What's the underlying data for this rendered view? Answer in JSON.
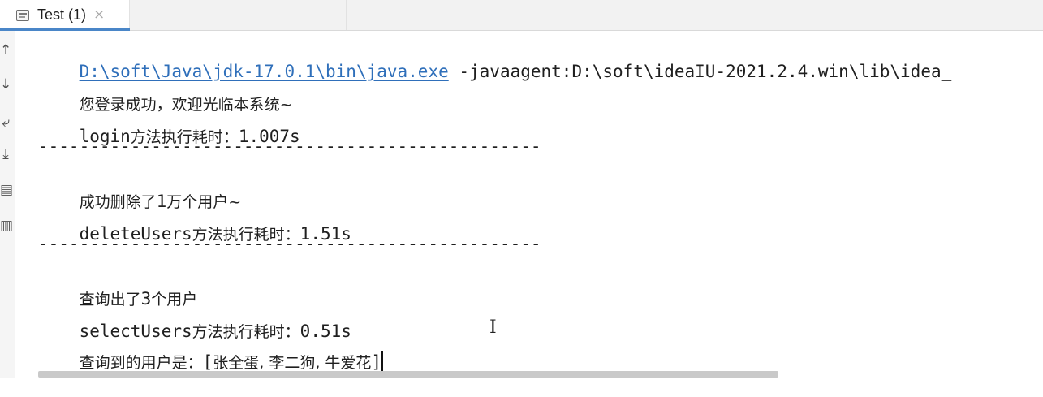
{
  "tab": {
    "label": "Test (1)",
    "icon": "console-tab-icon",
    "close_glyph": "×"
  },
  "gutter": {
    "icons": [
      "up-arrow-icon",
      "down-arrow-icon",
      "soft-wrap-icon",
      "scroll-to-end-icon",
      "print-icon",
      "trash-icon"
    ]
  },
  "console": {
    "cmd_path": "D:\\soft\\Java\\jdk-17.0.1\\bin\\java.exe",
    "cmd_args": " -javaagent:D:\\soft\\ideaIU-2021.2.4.win\\lib\\idea_",
    "line1": "您登录成功，欢迎光临本系统~",
    "line2_method": "login",
    "line2_text": "方法执行耗时：",
    "line2_value": "1.007s",
    "separator": "-------------------------------------------------",
    "line3_a": "成功删除了",
    "line3_num": "1",
    "line3_b": "万个用户~",
    "line4_method": "deleteUsers",
    "line4_text": "方法执行耗时：",
    "line4_value": "1.51s",
    "line5_a": "查询出了",
    "line5_num": "3",
    "line5_b": "个用户",
    "line6_method": "selectUsers",
    "line6_text": "方法执行耗时：",
    "line6_value": "0.51s",
    "line7_a": "查询到的用户是：",
    "line7_open": "[",
    "line7_names": "张全蛋, 李二狗, 牛爱花",
    "line7_close": "]"
  },
  "colors": {
    "link": "#2f6fba",
    "text": "#1f1f1f",
    "tab_accent": "#4a86c8"
  }
}
